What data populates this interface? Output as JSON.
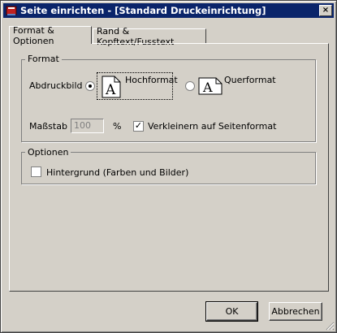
{
  "window": {
    "title": "Seite einrichten - [Standard Druckeinrichtung]",
    "close_glyph": "×"
  },
  "tabs": [
    {
      "label": "Format & Optionen",
      "active": true
    },
    {
      "label": "Rand & Kopftext/Fusstext",
      "active": false
    }
  ],
  "format_group": {
    "label": "Format",
    "orientation_label": "Abdruckbild",
    "portrait_label": "Hochformat",
    "portrait_selected": true,
    "landscape_label": "Querformat",
    "landscape_selected": false,
    "page_glyph": "A",
    "scale_label": "Maßstab",
    "scale_value": "100",
    "scale_unit": "%",
    "shrink_label": "Verkleinern auf Seitenformat",
    "shrink_checked": true
  },
  "options_group": {
    "label": "Optionen",
    "background_label": "Hintergrund (Farben und Bilder)",
    "background_checked": false
  },
  "buttons": {
    "ok": "OK",
    "cancel": "Abbrechen"
  },
  "colors": {
    "titlebar": "#0a246a",
    "face": "#d4d0c8"
  }
}
